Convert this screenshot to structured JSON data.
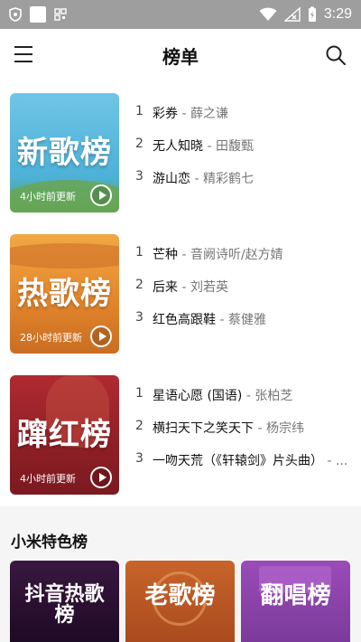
{
  "status_bar": {
    "time": "3:29"
  },
  "app_bar": {
    "title": "榜单"
  },
  "rankings": [
    {
      "cover_title": "新歌榜",
      "update_text": "4小时前更新",
      "songs": [
        {
          "rank": "1",
          "name": "彩券",
          "artist": "薛之谦"
        },
        {
          "rank": "2",
          "name": "无人知晓",
          "artist": "田馥甄"
        },
        {
          "rank": "3",
          "name": "游山恋",
          "artist": "精彩鹤七"
        }
      ]
    },
    {
      "cover_title": "热歌榜",
      "update_text": "28小时前更新",
      "songs": [
        {
          "rank": "1",
          "name": "芒种",
          "artist": "音阙诗听/赵方婧"
        },
        {
          "rank": "2",
          "name": "后来",
          "artist": "刘若英"
        },
        {
          "rank": "3",
          "name": "红色高跟鞋",
          "artist": "蔡健雅"
        }
      ]
    },
    {
      "cover_title": "蹿红榜",
      "update_text": "4小时前更新",
      "songs": [
        {
          "rank": "1",
          "name": "星语心愿 (国语)",
          "artist": "张柏芝"
        },
        {
          "rank": "2",
          "name": "横扫天下之笑天下",
          "artist": "杨宗纬"
        },
        {
          "rank": "3",
          "name": "一吻天荒（《轩辕剑》片头曲）",
          "artist": "..."
        }
      ]
    }
  ],
  "section": {
    "title": "小米特色榜",
    "tiles": [
      {
        "title": "抖音热歌榜"
      },
      {
        "title": "老歌榜"
      },
      {
        "title": "翻唱榜"
      }
    ]
  },
  "colors": {
    "status_bar": "#9e9e9e",
    "new_cover": "#5cbde0",
    "hot_cover": "#e48a2e",
    "rising_cover": "#a0242a"
  }
}
